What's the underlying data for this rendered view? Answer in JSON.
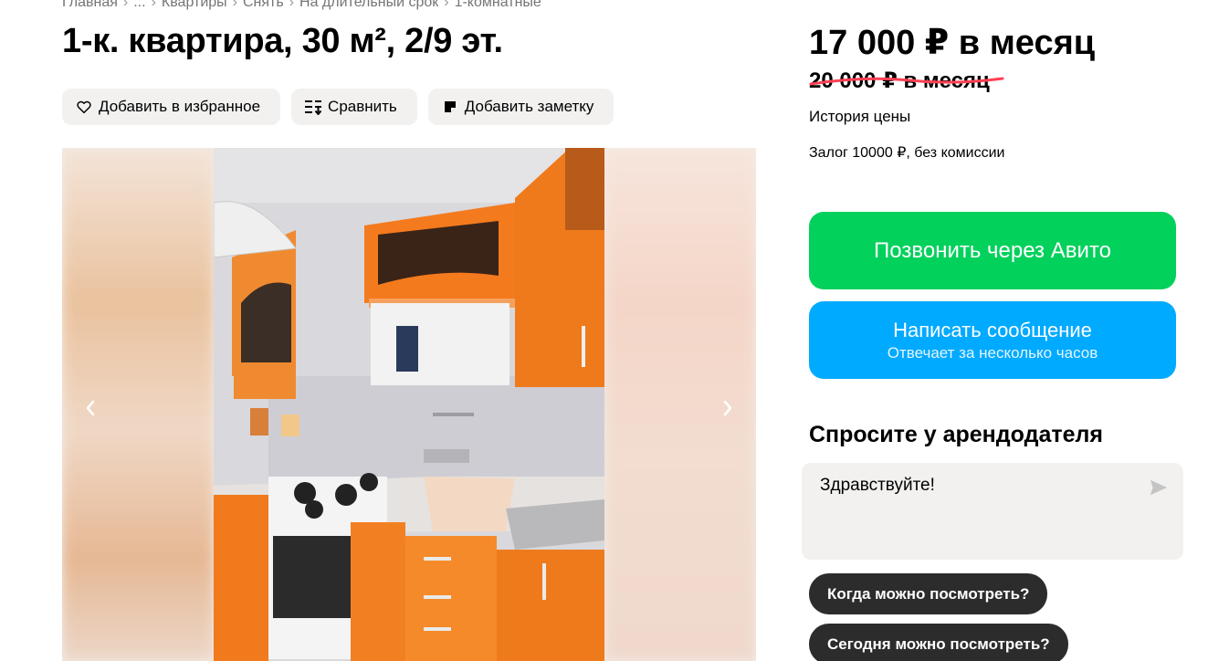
{
  "breadcrumb": [
    "Главная",
    "...",
    "Квартиры",
    "Снять",
    "На длительный срок",
    "1-комнатные"
  ],
  "listing": {
    "title": "1-к. квартира, 30 м², 2/9 эт.",
    "actions": {
      "favorite": "Добавить в избранное",
      "compare": "Сравнить",
      "note": "Добавить заметку"
    }
  },
  "pricing": {
    "price": "17 000 ₽ в месяц",
    "old_price": "20 000 ₽ в месяц",
    "history": "История цены",
    "deposit": "Залог 10000 ₽, без комиссии"
  },
  "contact": {
    "call": "Позвонить через Авито",
    "message": "Написать сообщение",
    "message_sub": "Отвечает за несколько часов"
  },
  "ask": {
    "title": "Спросите у арендодателя",
    "input_value": "Здравствуйте!",
    "quick_questions": [
      "Когда можно посмотреть?",
      "Сегодня можно посмотреть?"
    ]
  },
  "colors": {
    "call_green": "#02d15c",
    "message_blue": "#00aaff",
    "chip_dark": "#2c2c2c",
    "strike_red": "#ff4053"
  },
  "icons": {
    "favorite": "heart-icon",
    "compare": "compare-icon",
    "note": "note-icon",
    "send": "send-icon",
    "prev": "chevron-left-icon",
    "next": "chevron-right-icon"
  }
}
